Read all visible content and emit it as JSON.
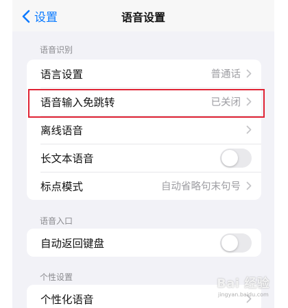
{
  "navbar": {
    "back_label": "设置",
    "title": "语音设置"
  },
  "sections": {
    "recognition": {
      "header": "语音识别",
      "rows": [
        {
          "label": "语言设置",
          "value": "普通话"
        },
        {
          "label": "语音输入免跳转",
          "value": "已关闭"
        },
        {
          "label": "离线语音",
          "value": ""
        },
        {
          "label": "长文本语音",
          "toggle": false
        },
        {
          "label": "标点模式",
          "value": "自动省略句末句号"
        }
      ]
    },
    "entry": {
      "header": "语音入口",
      "rows": [
        {
          "label": "自动返回键盘",
          "toggle": false
        }
      ]
    },
    "personal": {
      "header": "个性设置",
      "rows": [
        {
          "label": "个性化语音"
        }
      ]
    }
  },
  "watermark": {
    "logo": "Bai 经验",
    "url": "jingyan.baidu.com"
  },
  "colors": {
    "accent": "#0a7aff",
    "highlight": "#e02233",
    "background": "#f2f2f7",
    "secondary_text": "#9d9da2"
  },
  "icons": {
    "back": "chevron-left-icon",
    "row_chevron": "chevron-right-icon"
  }
}
